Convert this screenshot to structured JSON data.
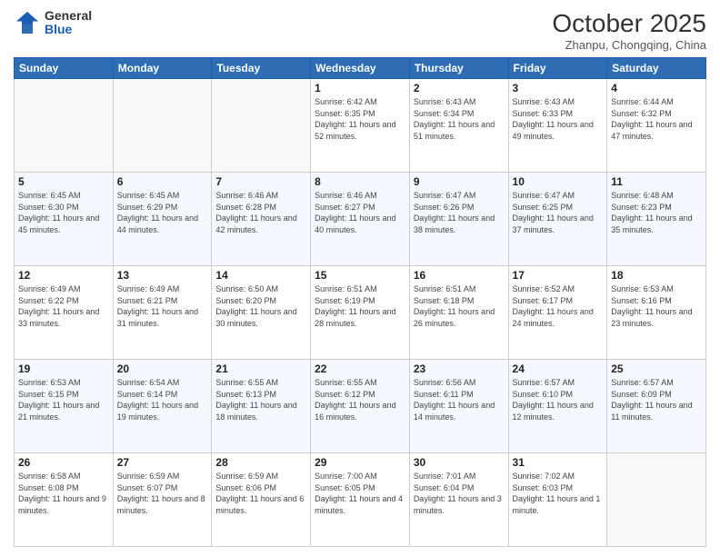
{
  "header": {
    "logo_general": "General",
    "logo_blue": "Blue",
    "month_title": "October 2025",
    "location": "Zhanpu, Chongqing, China"
  },
  "weekdays": [
    "Sunday",
    "Monday",
    "Tuesday",
    "Wednesday",
    "Thursday",
    "Friday",
    "Saturday"
  ],
  "weeks": [
    [
      {
        "day": "",
        "sunrise": "",
        "sunset": "",
        "daylight": ""
      },
      {
        "day": "",
        "sunrise": "",
        "sunset": "",
        "daylight": ""
      },
      {
        "day": "",
        "sunrise": "",
        "sunset": "",
        "daylight": ""
      },
      {
        "day": "1",
        "sunrise": "Sunrise: 6:42 AM",
        "sunset": "Sunset: 6:35 PM",
        "daylight": "Daylight: 11 hours and 52 minutes."
      },
      {
        "day": "2",
        "sunrise": "Sunrise: 6:43 AM",
        "sunset": "Sunset: 6:34 PM",
        "daylight": "Daylight: 11 hours and 51 minutes."
      },
      {
        "day": "3",
        "sunrise": "Sunrise: 6:43 AM",
        "sunset": "Sunset: 6:33 PM",
        "daylight": "Daylight: 11 hours and 49 minutes."
      },
      {
        "day": "4",
        "sunrise": "Sunrise: 6:44 AM",
        "sunset": "Sunset: 6:32 PM",
        "daylight": "Daylight: 11 hours and 47 minutes."
      }
    ],
    [
      {
        "day": "5",
        "sunrise": "Sunrise: 6:45 AM",
        "sunset": "Sunset: 6:30 PM",
        "daylight": "Daylight: 11 hours and 45 minutes."
      },
      {
        "day": "6",
        "sunrise": "Sunrise: 6:45 AM",
        "sunset": "Sunset: 6:29 PM",
        "daylight": "Daylight: 11 hours and 44 minutes."
      },
      {
        "day": "7",
        "sunrise": "Sunrise: 6:46 AM",
        "sunset": "Sunset: 6:28 PM",
        "daylight": "Daylight: 11 hours and 42 minutes."
      },
      {
        "day": "8",
        "sunrise": "Sunrise: 6:46 AM",
        "sunset": "Sunset: 6:27 PM",
        "daylight": "Daylight: 11 hours and 40 minutes."
      },
      {
        "day": "9",
        "sunrise": "Sunrise: 6:47 AM",
        "sunset": "Sunset: 6:26 PM",
        "daylight": "Daylight: 11 hours and 38 minutes."
      },
      {
        "day": "10",
        "sunrise": "Sunrise: 6:47 AM",
        "sunset": "Sunset: 6:25 PM",
        "daylight": "Daylight: 11 hours and 37 minutes."
      },
      {
        "day": "11",
        "sunrise": "Sunrise: 6:48 AM",
        "sunset": "Sunset: 6:23 PM",
        "daylight": "Daylight: 11 hours and 35 minutes."
      }
    ],
    [
      {
        "day": "12",
        "sunrise": "Sunrise: 6:49 AM",
        "sunset": "Sunset: 6:22 PM",
        "daylight": "Daylight: 11 hours and 33 minutes."
      },
      {
        "day": "13",
        "sunrise": "Sunrise: 6:49 AM",
        "sunset": "Sunset: 6:21 PM",
        "daylight": "Daylight: 11 hours and 31 minutes."
      },
      {
        "day": "14",
        "sunrise": "Sunrise: 6:50 AM",
        "sunset": "Sunset: 6:20 PM",
        "daylight": "Daylight: 11 hours and 30 minutes."
      },
      {
        "day": "15",
        "sunrise": "Sunrise: 6:51 AM",
        "sunset": "Sunset: 6:19 PM",
        "daylight": "Daylight: 11 hours and 28 minutes."
      },
      {
        "day": "16",
        "sunrise": "Sunrise: 6:51 AM",
        "sunset": "Sunset: 6:18 PM",
        "daylight": "Daylight: 11 hours and 26 minutes."
      },
      {
        "day": "17",
        "sunrise": "Sunrise: 6:52 AM",
        "sunset": "Sunset: 6:17 PM",
        "daylight": "Daylight: 11 hours and 24 minutes."
      },
      {
        "day": "18",
        "sunrise": "Sunrise: 6:53 AM",
        "sunset": "Sunset: 6:16 PM",
        "daylight": "Daylight: 11 hours and 23 minutes."
      }
    ],
    [
      {
        "day": "19",
        "sunrise": "Sunrise: 6:53 AM",
        "sunset": "Sunset: 6:15 PM",
        "daylight": "Daylight: 11 hours and 21 minutes."
      },
      {
        "day": "20",
        "sunrise": "Sunrise: 6:54 AM",
        "sunset": "Sunset: 6:14 PM",
        "daylight": "Daylight: 11 hours and 19 minutes."
      },
      {
        "day": "21",
        "sunrise": "Sunrise: 6:55 AM",
        "sunset": "Sunset: 6:13 PM",
        "daylight": "Daylight: 11 hours and 18 minutes."
      },
      {
        "day": "22",
        "sunrise": "Sunrise: 6:55 AM",
        "sunset": "Sunset: 6:12 PM",
        "daylight": "Daylight: 11 hours and 16 minutes."
      },
      {
        "day": "23",
        "sunrise": "Sunrise: 6:56 AM",
        "sunset": "Sunset: 6:11 PM",
        "daylight": "Daylight: 11 hours and 14 minutes."
      },
      {
        "day": "24",
        "sunrise": "Sunrise: 6:57 AM",
        "sunset": "Sunset: 6:10 PM",
        "daylight": "Daylight: 11 hours and 12 minutes."
      },
      {
        "day": "25",
        "sunrise": "Sunrise: 6:57 AM",
        "sunset": "Sunset: 6:09 PM",
        "daylight": "Daylight: 11 hours and 11 minutes."
      }
    ],
    [
      {
        "day": "26",
        "sunrise": "Sunrise: 6:58 AM",
        "sunset": "Sunset: 6:08 PM",
        "daylight": "Daylight: 11 hours and 9 minutes."
      },
      {
        "day": "27",
        "sunrise": "Sunrise: 6:59 AM",
        "sunset": "Sunset: 6:07 PM",
        "daylight": "Daylight: 11 hours and 8 minutes."
      },
      {
        "day": "28",
        "sunrise": "Sunrise: 6:59 AM",
        "sunset": "Sunset: 6:06 PM",
        "daylight": "Daylight: 11 hours and 6 minutes."
      },
      {
        "day": "29",
        "sunrise": "Sunrise: 7:00 AM",
        "sunset": "Sunset: 6:05 PM",
        "daylight": "Daylight: 11 hours and 4 minutes."
      },
      {
        "day": "30",
        "sunrise": "Sunrise: 7:01 AM",
        "sunset": "Sunset: 6:04 PM",
        "daylight": "Daylight: 11 hours and 3 minutes."
      },
      {
        "day": "31",
        "sunrise": "Sunrise: 7:02 AM",
        "sunset": "Sunset: 6:03 PM",
        "daylight": "Daylight: 11 hours and 1 minute."
      },
      {
        "day": "",
        "sunrise": "",
        "sunset": "",
        "daylight": ""
      }
    ]
  ]
}
